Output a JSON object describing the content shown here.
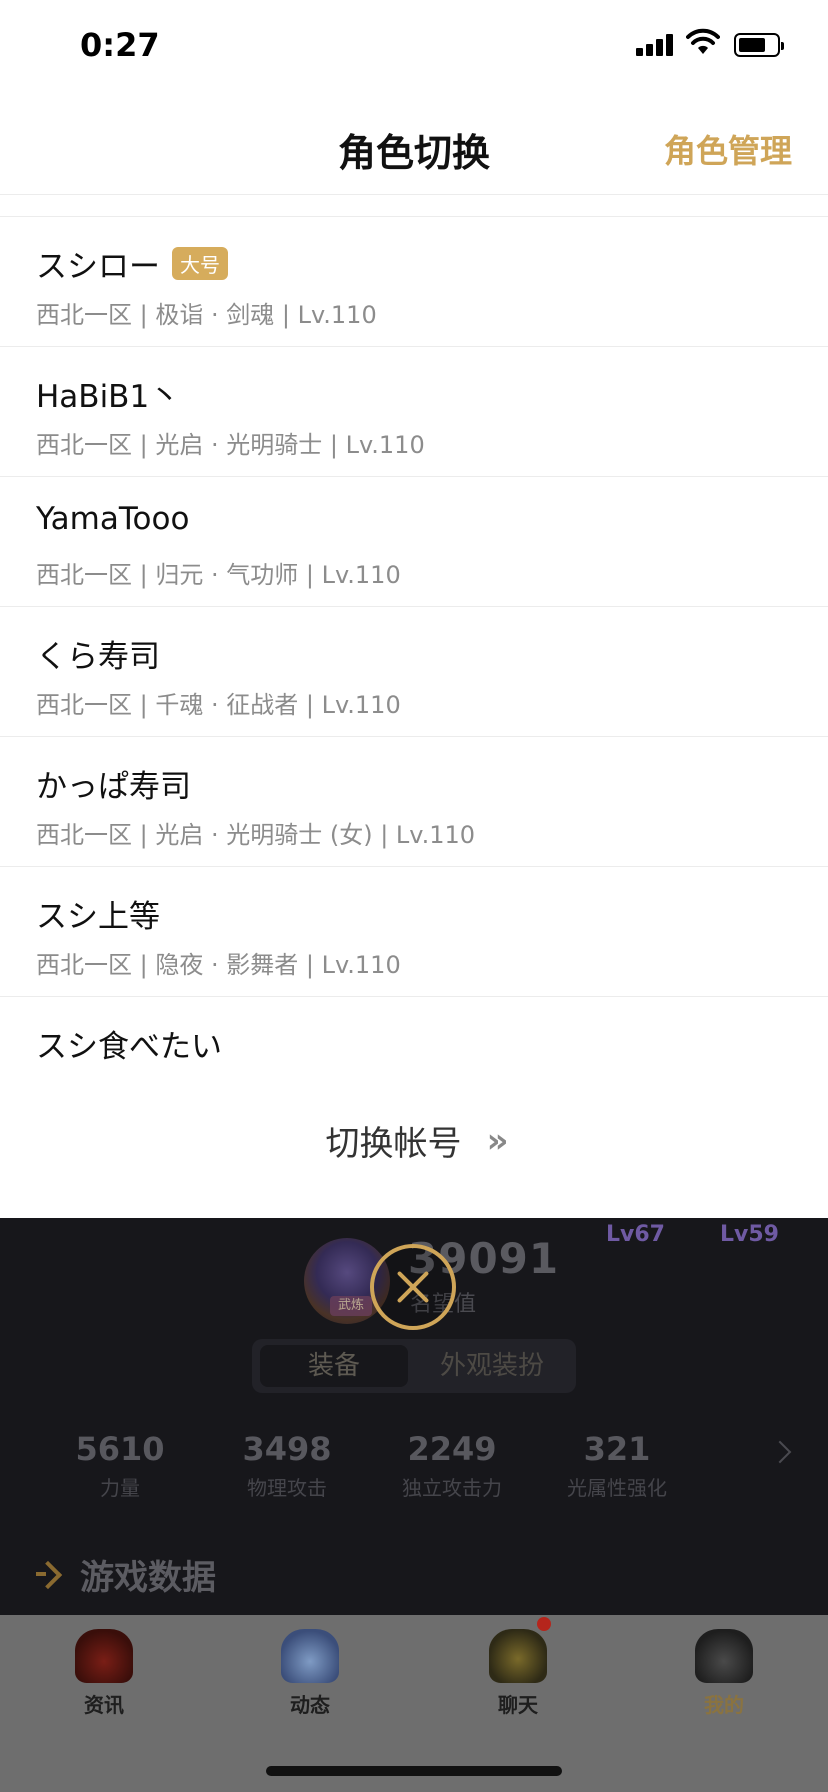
{
  "status_bar": {
    "time": "0:27"
  },
  "header": {
    "title": "角色切换",
    "manage_label": "角色管理"
  },
  "roles": [
    {
      "name": "スシロー",
      "tag": "大号",
      "meta": "西北一区 | 极诣 · 剑魂 | Lv.110"
    },
    {
      "name": "HaBiB1丶",
      "meta": "西北一区 | 光启 · 光明骑士 | Lv.110"
    },
    {
      "name": "YamaTooo",
      "meta": "西北一区 | 归元 · 气功师 | Lv.110"
    },
    {
      "name": "くら寿司",
      "meta": "西北一区 | 千魂 · 征战者 | Lv.110"
    },
    {
      "name": "かっぱ寿司",
      "meta": "西北一区 | 光启 · 光明骑士 (女) | Lv.110"
    },
    {
      "name": "スシ上等",
      "meta": "西北一区 | 隐夜 · 影舞者 | Lv.110"
    },
    {
      "name": "スシ食べたい",
      "meta": ""
    }
  ],
  "switch_account": {
    "label": "切换帐号",
    "chevron": "»"
  },
  "background": {
    "levels": [
      "Lv67",
      "Lv59"
    ],
    "emblem_tag": "武炼",
    "score": "39091",
    "score_label": "名望值",
    "tabs": [
      "装备",
      "外观装扮"
    ],
    "stats": [
      {
        "value": "5610",
        "label": "力量"
      },
      {
        "value": "3498",
        "label": "物理攻击"
      },
      {
        "value": "2249",
        "label": "独立攻击力"
      },
      {
        "value": "321",
        "label": "光属性强化"
      }
    ],
    "section_title": "游戏数据"
  },
  "tabbar": {
    "items": [
      {
        "label": "资讯",
        "icon": "news-avatar-icon"
      },
      {
        "label": "动态",
        "icon": "feed-avatar-icon"
      },
      {
        "label": "聊天",
        "icon": "chat-avatar-icon"
      },
      {
        "label": "我的",
        "icon": "me-avatar-icon"
      }
    ]
  },
  "colors": {
    "accent": "#cfa558",
    "tag_bg": "#d6ac5c",
    "badge": "#b5251c"
  }
}
